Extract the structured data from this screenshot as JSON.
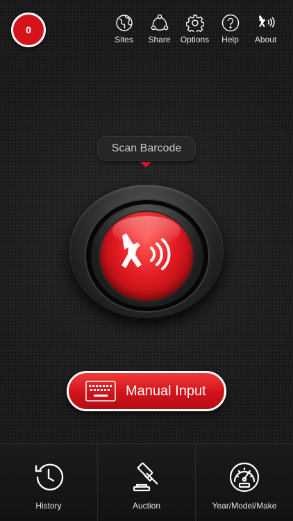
{
  "badge": {
    "count": "0"
  },
  "topnav": [
    {
      "label": "Sites",
      "icon": "globe-icon"
    },
    {
      "label": "Share",
      "icon": "share-icon"
    },
    {
      "label": "Options",
      "icon": "gear-icon"
    },
    {
      "label": "Help",
      "icon": "help-icon"
    },
    {
      "label": "About",
      "icon": "scanner-man-icon"
    }
  ],
  "scan": {
    "tooltip": "Scan Barcode",
    "icon": "scanner-man-icon"
  },
  "manual_input": {
    "label": "Manual Input",
    "icon": "keyboard-icon"
  },
  "bottom_tabs": [
    {
      "label": "History",
      "icon": "history-clock-icon"
    },
    {
      "label": "Auction",
      "icon": "gavel-icon"
    },
    {
      "label": "Year/Model/Make",
      "icon": "speedometer-icon"
    }
  ],
  "colors": {
    "accent": "#d6121b",
    "background": "#1c1c1c",
    "text": "#ffffff"
  }
}
